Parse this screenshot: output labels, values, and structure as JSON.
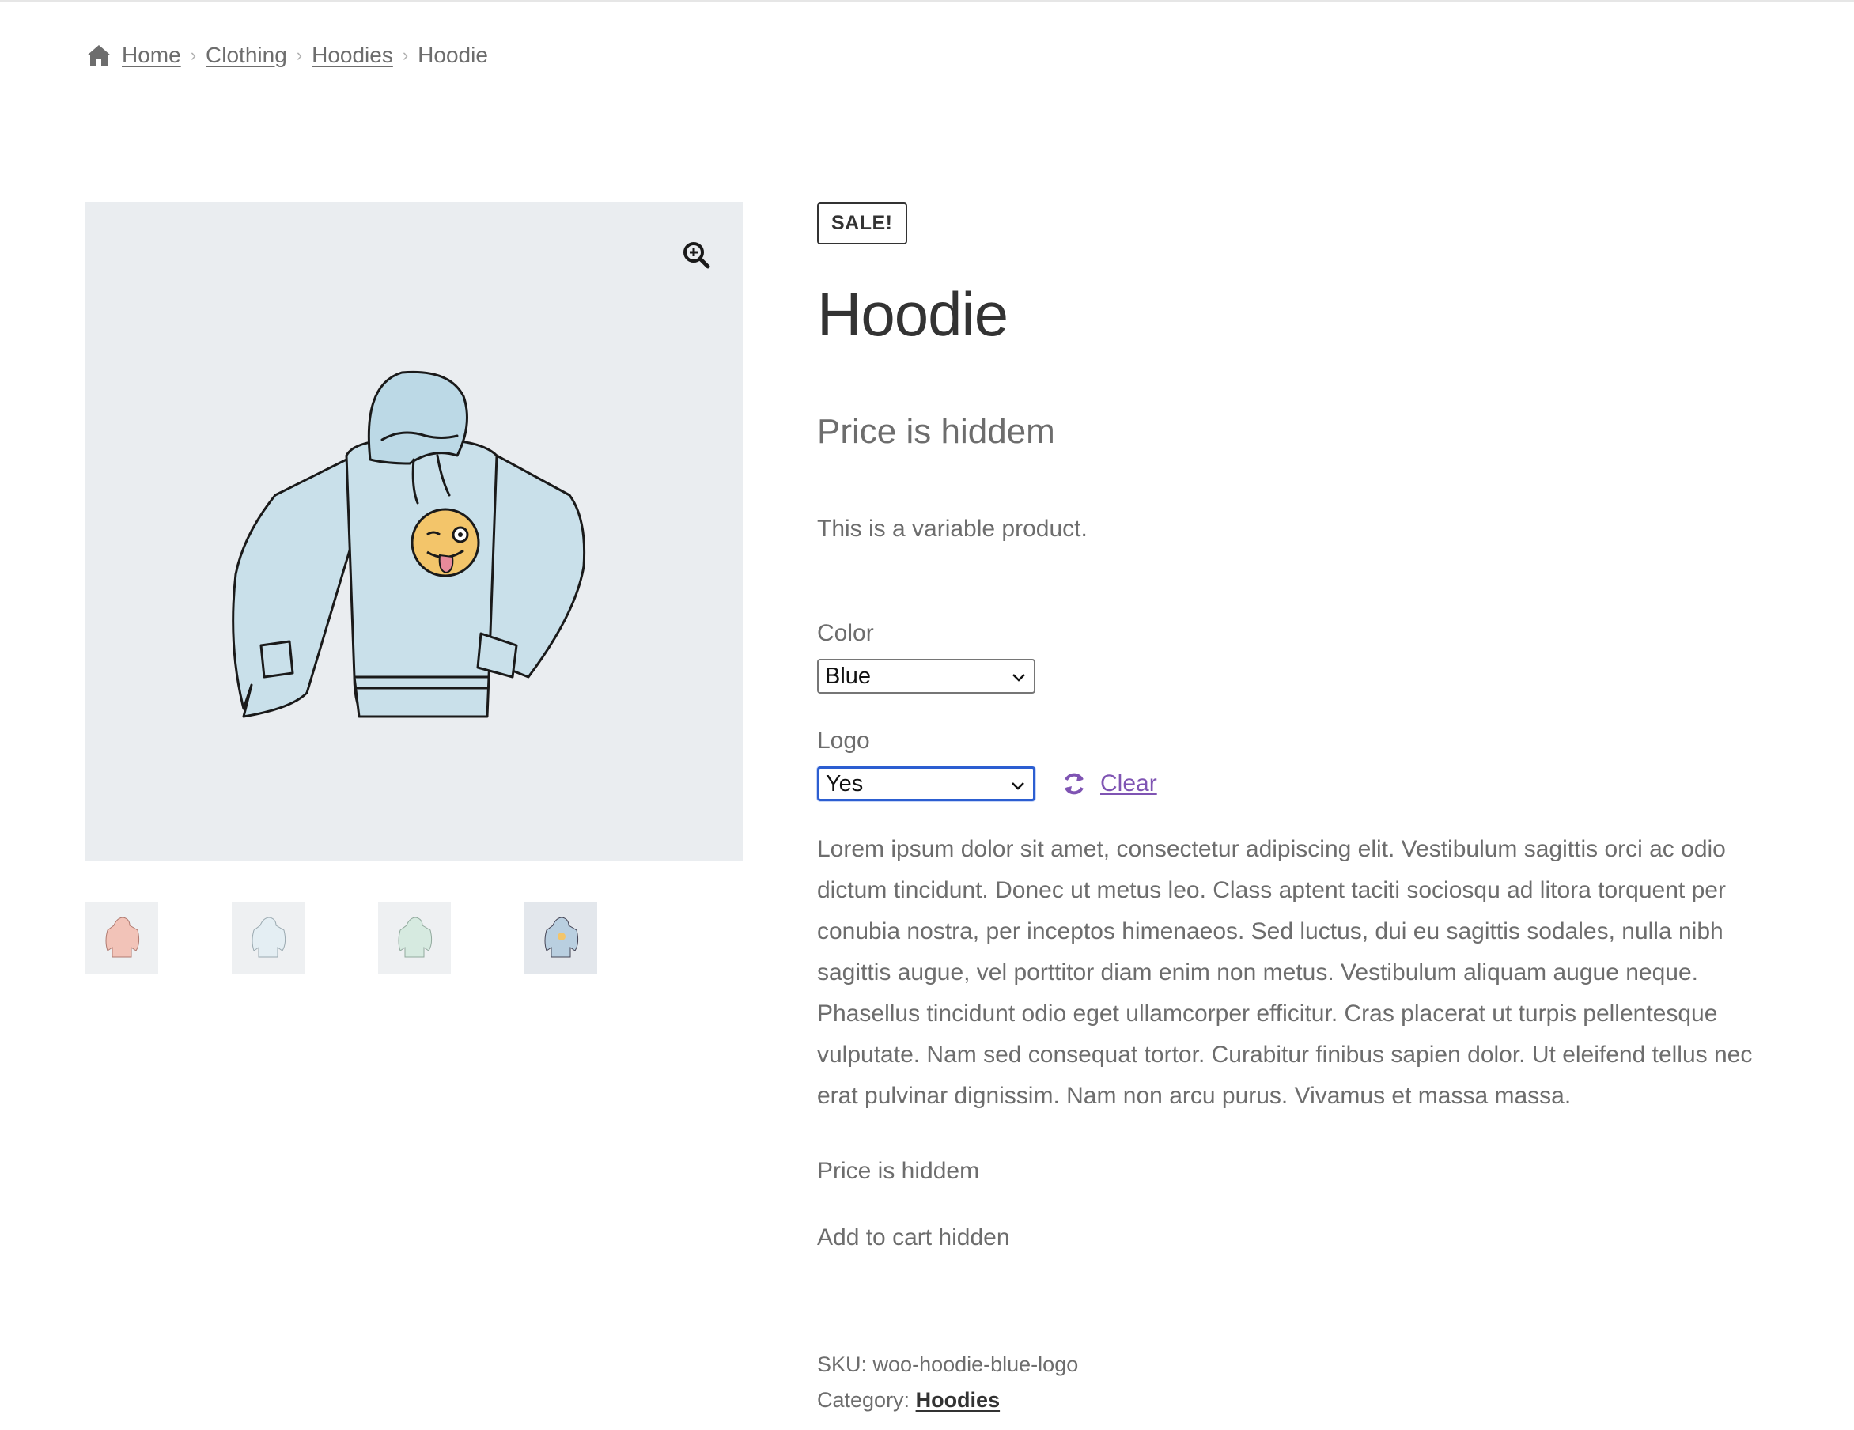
{
  "breadcrumb": {
    "items": [
      "Home",
      "Clothing",
      "Hoodies"
    ],
    "current": "Hoodie"
  },
  "product": {
    "sale_badge": "SALE!",
    "title": "Hoodie",
    "price_text": "Price is hiddem",
    "short_description": "This is a variable product.",
    "variations": {
      "color_label": "Color",
      "color_value": "Blue",
      "logo_label": "Logo",
      "logo_value": "Yes",
      "clear_label": "Clear"
    },
    "description": "Lorem ipsum dolor sit amet, consectetur adipiscing elit. Vestibulum sagittis orci ac odio dictum tincidunt. Donec ut metus leo. Class aptent taciti sociosqu ad litora torquent per conubia nostra, per inceptos himenaeos. Sed luctus, dui eu sagittis sodales, nulla nibh sagittis augue, vel porttitor diam enim non metus. Vestibulum aliquam augue neque. Phasellus tincidunt odio eget ullamcorper efficitur. Cras placerat ut turpis pellentesque vulputate. Nam sed consequat tortor. Curabitur finibus sapien dolor. Ut eleifend tellus nec erat pulvinar dignissim. Nam non arcu purus. Vivamus et massa massa.",
    "price_bottom": "Price is hiddem",
    "add_to_cart": "Add to cart hidden",
    "meta": {
      "sku_label": "SKU:",
      "sku_value": "woo-hoodie-blue-logo",
      "category_label": "Category:",
      "category_value": "Hoodies"
    }
  },
  "gallery": {
    "main_image": "hoodie-blue-logo-illustration",
    "thumbnails": [
      "hoodie-pink",
      "hoodie-light-blue",
      "hoodie-green",
      "hoodie-blue-logo"
    ]
  },
  "colors": {
    "accent": "#7f54b3",
    "focus": "#2c5ed1",
    "text": "#6d6d6d",
    "heading": "#333333",
    "image_bg": "#eaedf0"
  }
}
